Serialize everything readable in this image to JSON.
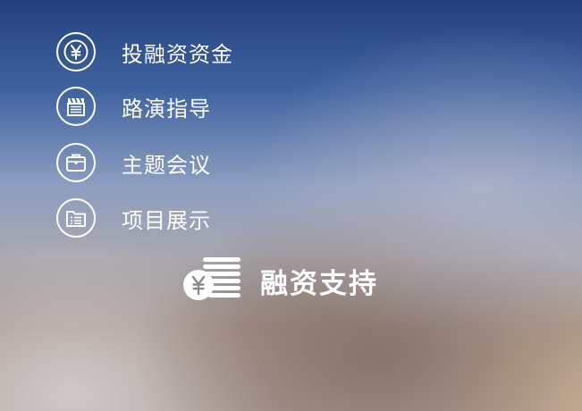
{
  "menu": {
    "items": [
      {
        "label": "投融资资金",
        "icon": "yen-coin-icon"
      },
      {
        "label": "路演指导",
        "icon": "clapperboard-icon"
      },
      {
        "label": "主题会议",
        "icon": "briefcase-icon"
      },
      {
        "label": "项目展示",
        "icon": "folder-list-icon"
      }
    ]
  },
  "brand": {
    "label": "融资支持",
    "icon": "yen-coin-stack-icon"
  }
}
